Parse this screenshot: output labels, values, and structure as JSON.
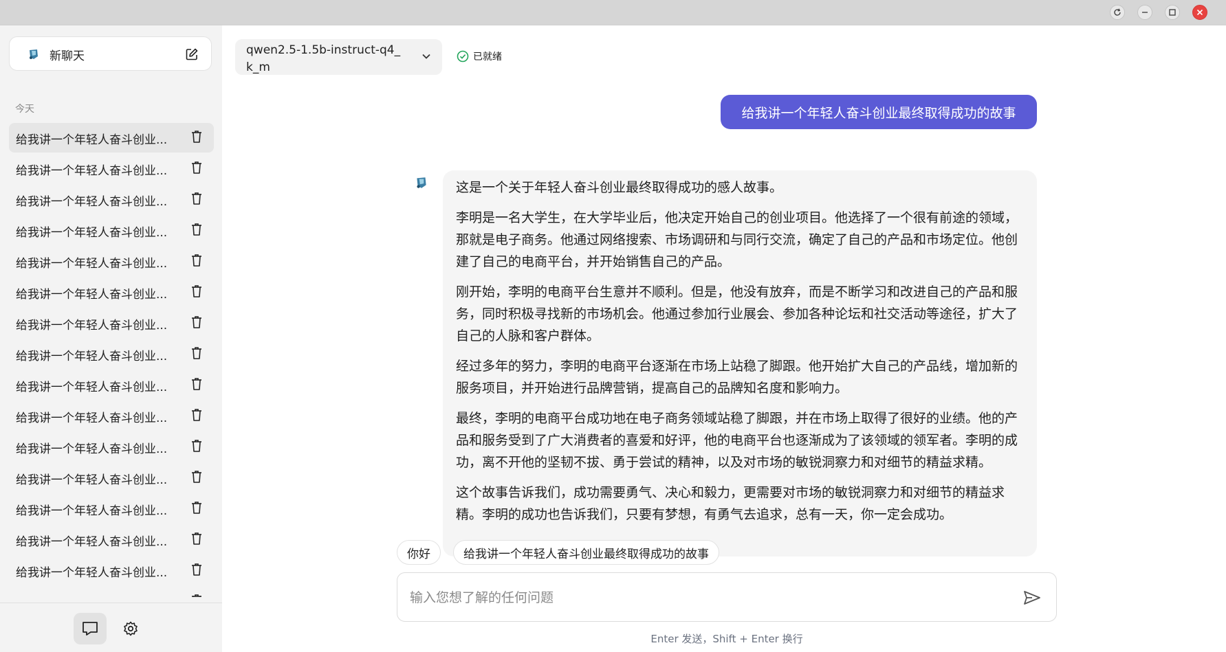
{
  "window": {
    "buttons": [
      "reload",
      "minimize",
      "maximize",
      "close"
    ]
  },
  "sidebar": {
    "new_chat_label": "新聊天",
    "section_label": "今天",
    "history": [
      "给我讲一个年轻人奋斗创业...",
      "给我讲一个年轻人奋斗创业...",
      "给我讲一个年轻人奋斗创业...",
      "给我讲一个年轻人奋斗创业...",
      "给我讲一个年轻人奋斗创业...",
      "给我讲一个年轻人奋斗创业...",
      "给我讲一个年轻人奋斗创业...",
      "给我讲一个年轻人奋斗创业...",
      "给我讲一个年轻人奋斗创业...",
      "给我讲一个年轻人奋斗创业...",
      "给我讲一个年轻人奋斗创业...",
      "给我讲一个年轻人奋斗创业...",
      "给我讲一个年轻人奋斗创业...",
      "给我讲一个年轻人奋斗创业...",
      "给我讲一个年轻人奋斗创业...",
      "给我讲一个年轻人奋斗创业..."
    ],
    "footer_icons": [
      "chat-icon",
      "settings-icon"
    ]
  },
  "header": {
    "model": "qwen2.5-1.5b-instruct-q4_k_m",
    "status": "已就绪"
  },
  "chat": {
    "user_message": "给我讲一个年轻人奋斗创业最终取得成功的故事",
    "bot_paragraphs": [
      "这是一个关于年轻人奋斗创业最终取得成功的感人故事。",
      "李明是一名大学生，在大学毕业后，他决定开始自己的创业项目。他选择了一个很有前途的领域，那就是电子商务。他通过网络搜索、市场调研和与同行交流，确定了自己的产品和市场定位。他创建了自己的电商平台，并开始销售自己的产品。",
      "刚开始，李明的电商平台生意并不顺利。但是，他没有放弃，而是不断学习和改进自己的产品和服务，同时积极寻找新的市场机会。他通过参加行业展会、参加各种论坛和社交活动等途径，扩大了自己的人脉和客户群体。",
      "经过多年的努力，李明的电商平台逐渐在市场上站稳了脚跟。他开始扩大自己的产品线，增加新的服务项目，并开始进行品牌营销，提高自己的品牌知名度和影响力。",
      "最终，李明的电商平台成功地在电子商务领域站稳了脚跟，并在市场上取得了很好的业绩。他的产品和服务受到了广大消费者的喜爱和好评，他的电商平台也逐渐成为了该领域的领军者。李明的成功，离不开他的坚韧不拔、勇于尝试的精神，以及对市场的敏锐洞察力和对细节的精益求精。",
      "这个故事告诉我们，成功需要勇气、决心和毅力，更需要对市场的敏锐洞察力和对细节的精益求精。李明的成功也告诉我们，只要有梦想，有勇气去追求，总有一天，你一定会成功。"
    ]
  },
  "suggestions": [
    "你好",
    "给我讲一个年轻人奋斗创业最终取得成功的故事"
  ],
  "input": {
    "placeholder": "输入您想了解的任何问题",
    "value": ""
  },
  "hint": "Enter 发送，Shift + Enter 换行",
  "colors": {
    "accent": "#5b5bd6",
    "status_ok": "#22a55b",
    "close": "#e84340"
  }
}
